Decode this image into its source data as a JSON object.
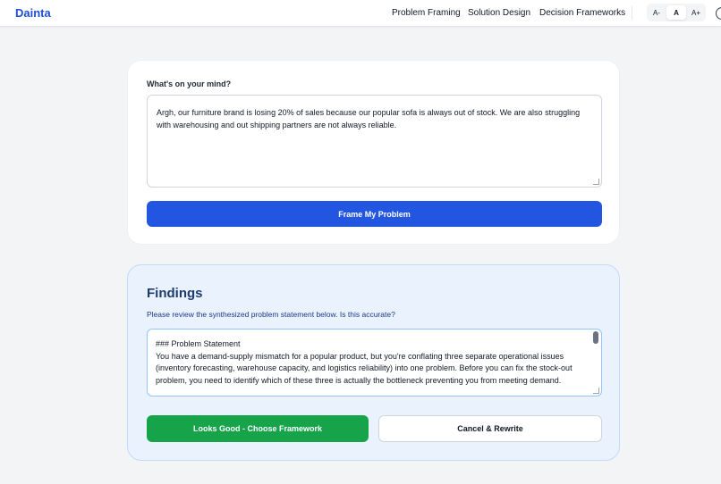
{
  "header": {
    "logo": "Dainta",
    "nav": [
      {
        "label": "Problem Framing"
      },
      {
        "label": "Solution Design"
      },
      {
        "label": "Decision Frameworks"
      }
    ],
    "font_controls": [
      {
        "label": "A-"
      },
      {
        "label": "A"
      },
      {
        "label": "A+"
      }
    ]
  },
  "input_card": {
    "label": "What's on your mind?",
    "value": "Argh, our furniture brand is losing 20% of sales because our popular sofa is always out of stock. We are also struggling with warehousing and out shipping partners are not always reliable.",
    "button": "Frame My Problem"
  },
  "findings": {
    "title": "Findings",
    "subtitle": "Please review the synthesized problem statement below. Is this accurate?",
    "lines": [
      "### Problem Statement",
      "You have a demand-supply mismatch for a popular product, but you're conflating three separate operational issues",
      "(inventory forecasting, warehouse capacity, and logistics reliability) into one problem. Before you can fix the stock-out",
      "problem, you need to identify which of these three is actually the bottleneck preventing you from meeting demand."
    ],
    "accept_button": "Looks Good - Choose Framework",
    "cancel_button": "Cancel & Rewrite"
  },
  "colors": {
    "brand": "#1d4ed8",
    "primary_button": "#2356e0",
    "accept_button": "#16a34a",
    "findings_bg": "#eaf2fd"
  }
}
